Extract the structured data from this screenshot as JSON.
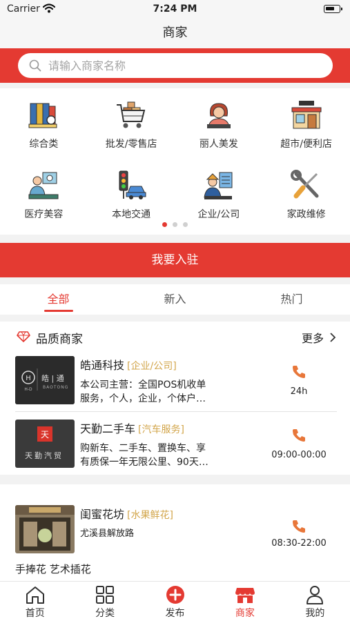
{
  "status_bar": {
    "carrier": "Carrier",
    "time": "7:24 PM"
  },
  "nav": {
    "title": "商家"
  },
  "search": {
    "placeholder": "请输入商家名称"
  },
  "categories": [
    {
      "label": "综合类",
      "icon": "binders-icon"
    },
    {
      "label": "批发/零售店",
      "icon": "shopping-cart-icon"
    },
    {
      "label": "丽人美发",
      "icon": "hairdresser-icon"
    },
    {
      "label": "超市/便利店",
      "icon": "shop-icon"
    },
    {
      "label": "医疗美容",
      "icon": "medical-consult-icon"
    },
    {
      "label": "本地交通",
      "icon": "traffic-light-icon"
    },
    {
      "label": "企业/公司",
      "icon": "business-icon"
    },
    {
      "label": "家政维修",
      "icon": "wrench-screwdriver-icon"
    }
  ],
  "pager": {
    "count": 3,
    "active": 0
  },
  "join_label": "我要入驻",
  "tabs": [
    {
      "label": "全部",
      "active": true
    },
    {
      "label": "新入",
      "active": false
    },
    {
      "label": "热门",
      "active": false
    }
  ],
  "quality": {
    "title": "品质商家",
    "more": "更多",
    "merchants": [
      {
        "name": "皓通科技",
        "tag": "[企业/公司]",
        "desc_line1": "本公司主营：全国POS机收单",
        "desc_line2": "服务，个人，企业，个体户…",
        "hours": "24h",
        "logo_text": "皓 | 通",
        "logo_sub": "BAOTONG"
      },
      {
        "name": "天勤二手车",
        "tag": "[汽车服务]",
        "desc_line1": "购新车、二手车、置换车、享",
        "desc_line2": "有质保一年无限公里、90天…",
        "hours": "09:00-00:00",
        "logo_text": "天勤汽贸"
      }
    ]
  },
  "shop": {
    "name": "闺蜜花坊",
    "tag": "[水果鲜花]",
    "address": "尤溪县解放路",
    "hours": "08:30-22:00",
    "tags_line": "手捧花 艺术插花"
  },
  "tab_bar": [
    {
      "label": "首页",
      "icon": "home-icon",
      "active": false
    },
    {
      "label": "分类",
      "icon": "grid-icon",
      "active": false
    },
    {
      "label": "发布",
      "icon": "plus-circle-icon",
      "active": false
    },
    {
      "label": "商家",
      "icon": "store-icon",
      "active": true
    },
    {
      "label": "我的",
      "icon": "person-icon",
      "active": false
    }
  ],
  "colors": {
    "brand_red": "#e43a32",
    "tag_gold": "#d2a54a"
  }
}
